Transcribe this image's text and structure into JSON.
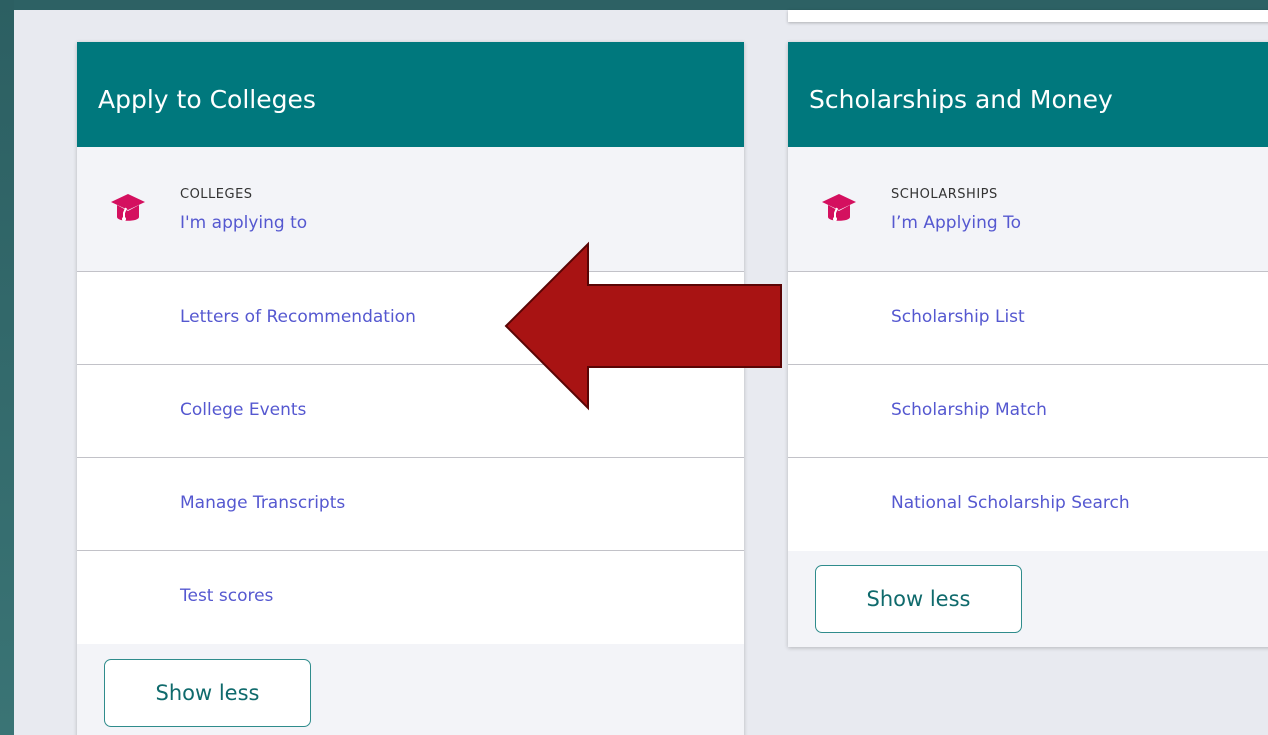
{
  "colleges_card": {
    "title": "Apply to Colleges",
    "icon": "graduation-cap-icon",
    "caption": "COLLEGES",
    "primary_link": "I'm applying to",
    "links": [
      "Letters of Recommendation",
      "College Events",
      "Manage Transcripts",
      "Test scores"
    ],
    "show_less_label": "Show less"
  },
  "scholarships_card": {
    "title": "Scholarships and Money",
    "icon": "graduation-cap-icon",
    "caption": "SCHOLARSHIPS",
    "primary_link": "I’m Applying To",
    "links": [
      "Scholarship List",
      "Scholarship Match",
      "National Scholarship Search"
    ],
    "show_less_label": "Show less"
  },
  "annotation": {
    "shape": "arrow-left",
    "color": "#a81313",
    "points_to": "Letters of Recommendation"
  },
  "colors": {
    "header": "#00787d",
    "link": "#5558d0",
    "icon": "#d4105f",
    "button_text": "#0f6a6c"
  }
}
